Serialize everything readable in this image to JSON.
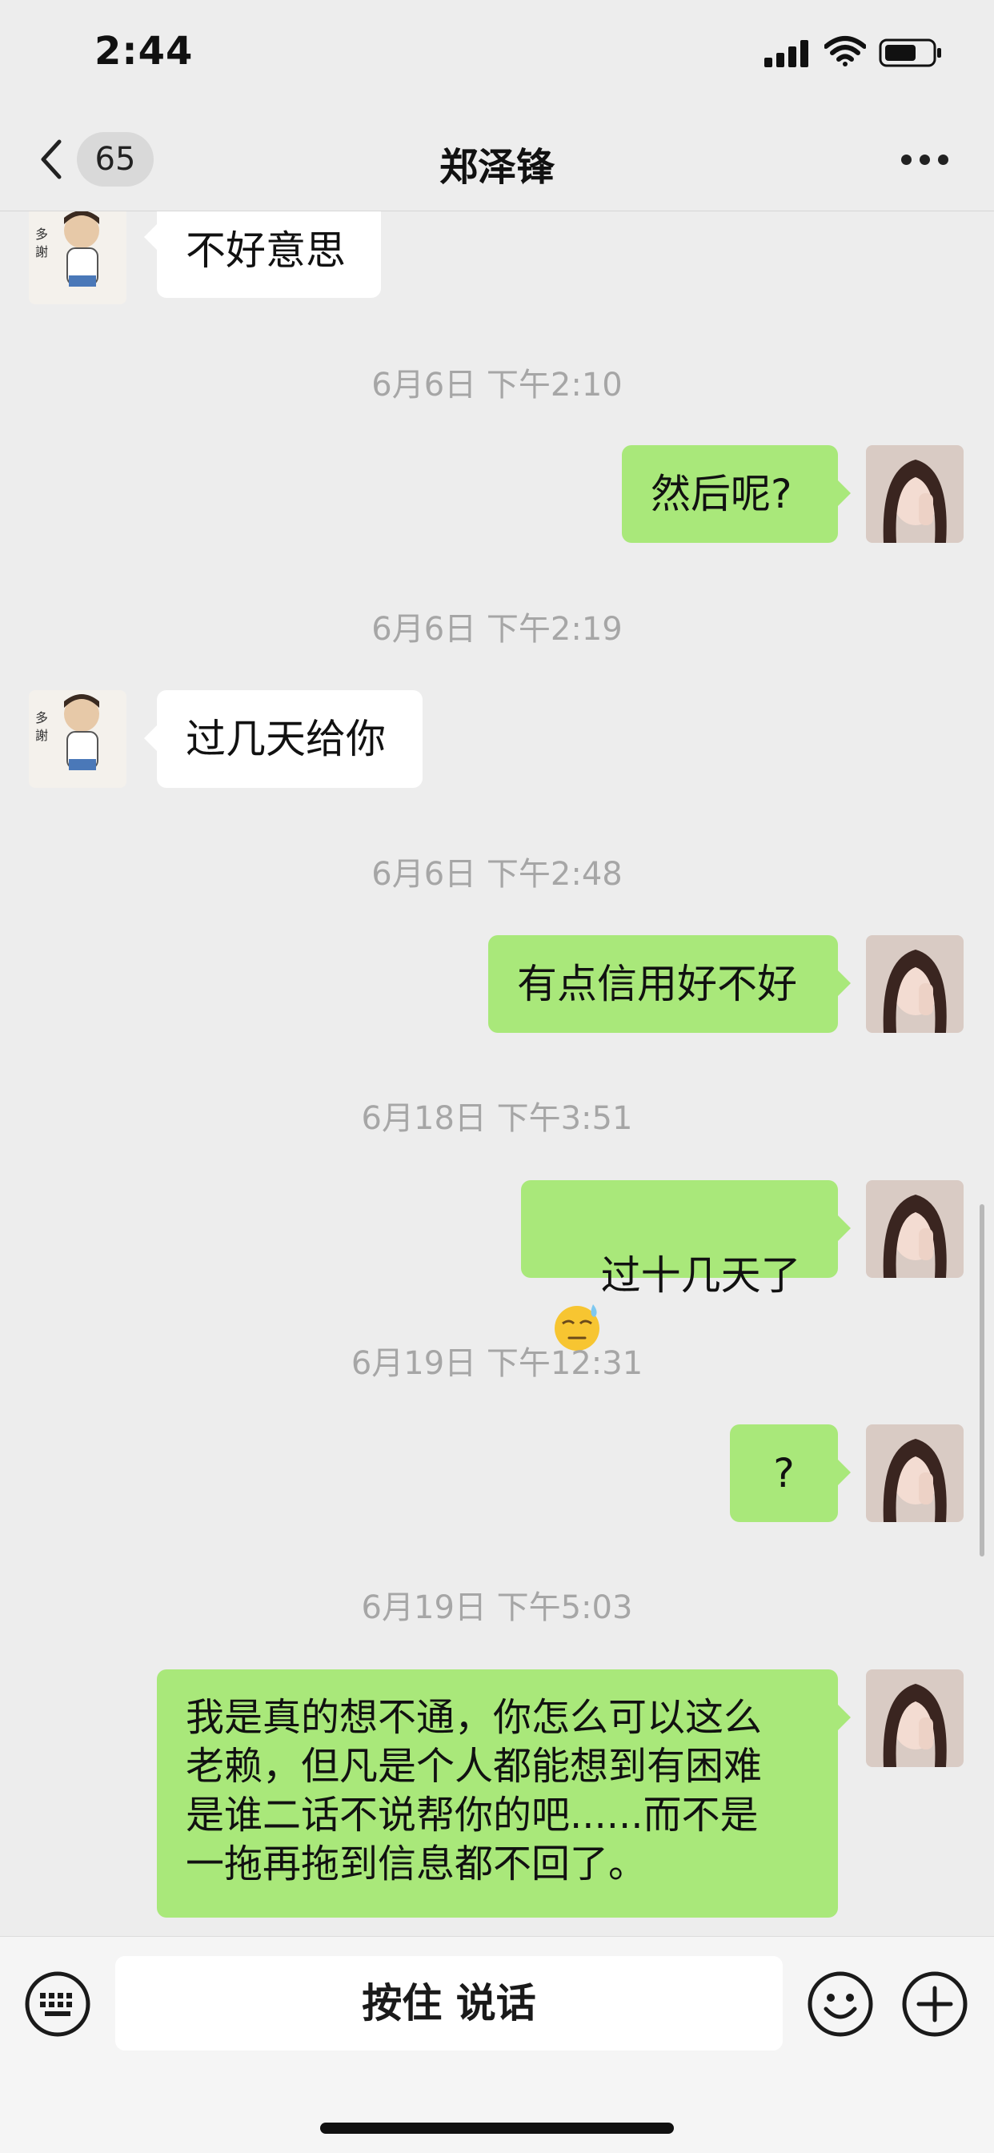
{
  "status_bar": {
    "time": "2:44"
  },
  "nav": {
    "unread_count": "65",
    "title": "郑泽锋"
  },
  "messages": [
    {
      "side": "left",
      "text": "不好意思"
    },
    {
      "timestamp": "6月6日 下午2:10"
    },
    {
      "side": "right",
      "text": "然后呢?"
    },
    {
      "timestamp": "6月6日 下午2:19"
    },
    {
      "side": "left",
      "text": "过几天给你"
    },
    {
      "timestamp": "6月6日 下午2:48"
    },
    {
      "side": "right",
      "text": "有点信用好不好"
    },
    {
      "timestamp": "6月18日 下午3:51"
    },
    {
      "side": "right",
      "text": "过十几天了",
      "emoji": "anxious-sweat-emoji"
    },
    {
      "timestamp": "6月19日 下午12:31"
    },
    {
      "side": "right",
      "text": "?"
    },
    {
      "timestamp": "6月19日 下午5:03"
    },
    {
      "side": "right",
      "text": "我是真的想不通，你怎么可以这么\n老赖，但凡是个人都能想到有困难\n是谁二话不说帮你的吧......而不是\n一拖再拖到信息都不回了。"
    }
  ],
  "input_bar": {
    "talk_label": "按住 说话"
  },
  "colors": {
    "sent_bubble": "#a9e87a",
    "received_bubble": "#ffffff",
    "background": "#ededed",
    "timestamp": "#a6a6a6"
  },
  "icons": [
    "back-icon",
    "more-icon",
    "keyboard-icon",
    "smile-icon",
    "plus-icon"
  ]
}
